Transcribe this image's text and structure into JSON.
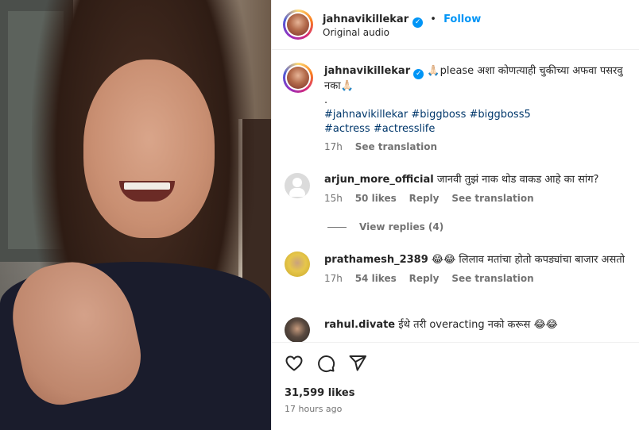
{
  "post": {
    "username": "jahnavikillekar",
    "follow_label": "Follow",
    "separator": "•",
    "audio": "Original audio",
    "verified_glyph": "✓"
  },
  "caption": {
    "username": "jahnavikillekar",
    "text": "🙏🏻please अशा कोणत्याही चुकीच्या अफवा पसरवु नका🙏🏻",
    "dot": ".",
    "hashtags_line1": "#jahnavikillekar #biggboss #biggboss5",
    "hashtags_line2": "#actress #actresslife",
    "time": "17h",
    "see_translation": "See translation"
  },
  "comments": [
    {
      "username": "arjun_more_official",
      "text": "जानवी तुझं नाक थोड वाकड आहे का सांग?",
      "time": "15h",
      "likes": "50 likes",
      "reply": "Reply",
      "see_translation": "See translation",
      "view_replies": "View replies (4)"
    },
    {
      "username": "prathamesh_2389",
      "text": "😂😂 लिलाव मतांचा होतो कपड्यांचा बाजार असतो",
      "time": "17h",
      "likes": "54 likes",
      "reply": "Reply",
      "see_translation": "See translation"
    },
    {
      "username": "rahul.divate",
      "text": "ईथे तरी overacting नको करूस 😂😂"
    }
  ],
  "footer": {
    "likes": "31,599 likes",
    "posted": "17 hours ago"
  },
  "icons": {
    "like": "heart-icon",
    "comment": "comment-icon",
    "share": "share-icon"
  },
  "colors": {
    "accent": "#0095f6",
    "hashtag": "#00376b",
    "muted": "#737373",
    "text": "#262626"
  }
}
